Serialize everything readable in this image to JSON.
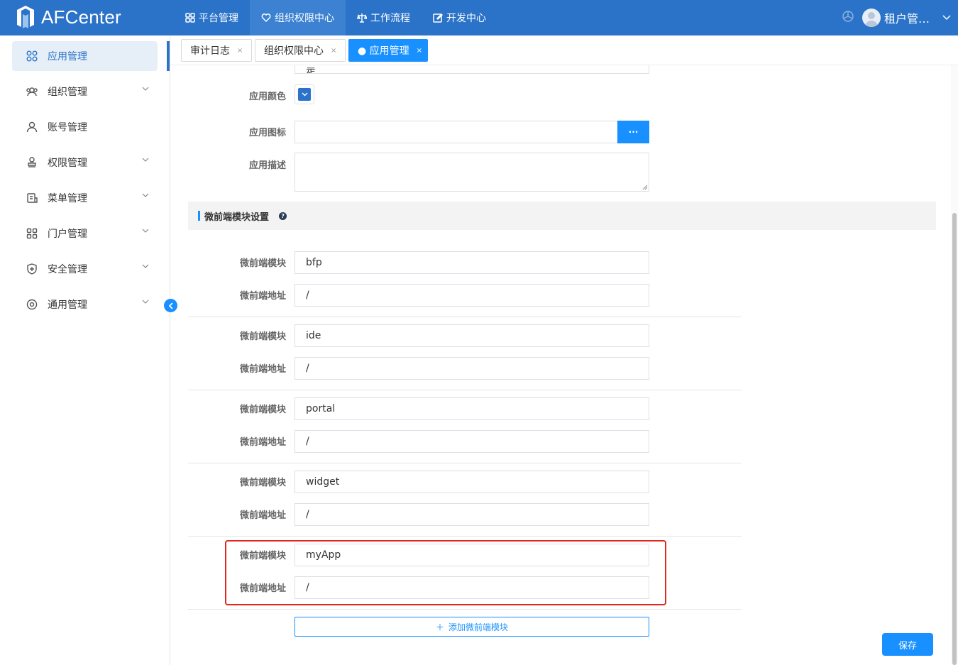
{
  "app": {
    "title": "AFCenter"
  },
  "topnav": [
    {
      "label": "平台管理",
      "icon": "grid-icon"
    },
    {
      "label": "组织权限中心",
      "icon": "heart-icon"
    },
    {
      "label": "工作流程",
      "icon": "workflow-icon"
    },
    {
      "label": "开发中心",
      "icon": "edit-icon"
    }
  ],
  "user": {
    "name": "租户管…"
  },
  "sidebar": {
    "items": [
      {
        "label": "应用管理"
      },
      {
        "label": "组织管理"
      },
      {
        "label": "账号管理"
      },
      {
        "label": "权限管理"
      },
      {
        "label": "菜单管理"
      },
      {
        "label": "门户管理"
      },
      {
        "label": "安全管理"
      },
      {
        "label": "通用管理"
      }
    ]
  },
  "tabs": [
    {
      "label": "审计日志",
      "close": "×"
    },
    {
      "label": "组织权限中心",
      "close": "×"
    },
    {
      "label": "● 应用管理",
      "close": "×"
    }
  ],
  "form": {
    "partial_label": "",
    "partial_value": "是",
    "color_label": "应用颜色",
    "icon_label": "应用图标",
    "icon_button": "···",
    "desc_label": "应用描述",
    "desc_value": ""
  },
  "section": {
    "title": "微前端模块设置",
    "help_icon": "?"
  },
  "modules": [
    {
      "module_label": "微前端模块",
      "module_value": "bfp",
      "addr_label": "微前端地址",
      "addr_value": "/"
    },
    {
      "module_label": "微前端模块",
      "module_value": "ide",
      "addr_label": "微前端地址",
      "addr_value": "/"
    },
    {
      "module_label": "微前端模块",
      "module_value": "portal",
      "addr_label": "微前端地址",
      "addr_value": "/"
    },
    {
      "module_label": "微前端模块",
      "module_value": "widget",
      "addr_label": "微前端地址",
      "addr_value": "/"
    },
    {
      "module_label": "微前端模块",
      "module_value": "myApp",
      "addr_label": "微前端地址",
      "addr_value": "/"
    }
  ],
  "actions": {
    "add_module": "添加微前端模块",
    "add_icon": "＋",
    "save": "保存"
  },
  "colors": {
    "header": "#2b73c8",
    "primary": "#1890ff",
    "highlight": "#e0281f"
  }
}
